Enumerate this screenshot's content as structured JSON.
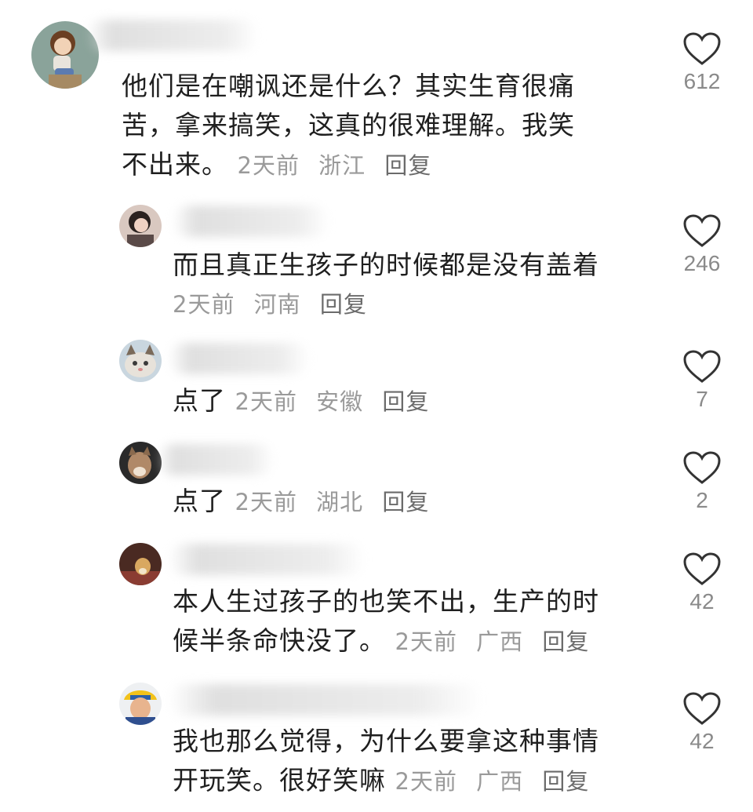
{
  "colors": {
    "text": "#1f1f1f",
    "meta": "#9a9a9a",
    "reply": "#6b6b6b",
    "heart": "#333333",
    "count": "#8a8a8a"
  },
  "comments": [
    {
      "kind": "top",
      "avatar_icon": "cartoon-girl-avatar-icon",
      "text": "他们是在嘲讽还是什么？其实生育很痛苦，拿来搞笑，这真的很难理解。我笑不出来。",
      "text_lines": [
        "他们是在嘲讽还是什么？其实生育很痛",
        "苦，拿来搞笑，这真的很难理解。我笑",
        "不出来。"
      ],
      "time": "2天前",
      "location": "浙江",
      "reply": "回复",
      "likes": "612"
    },
    {
      "kind": "reply",
      "avatar_icon": "woman-photo-avatar-icon",
      "text_lines": [
        "而且真正生孩子的时候都是没有盖着"
      ],
      "time": "2天前",
      "location": "河南",
      "reply": "回复",
      "likes": "246"
    },
    {
      "kind": "reply",
      "avatar_icon": "cat-avatar-icon",
      "text_lines": [
        "点了"
      ],
      "time": "2天前",
      "location": "安徽",
      "reply": "回复",
      "likes": "7"
    },
    {
      "kind": "reply",
      "avatar_icon": "cat-photo-avatar-icon",
      "text_lines": [
        "点了"
      ],
      "time": "2天前",
      "location": "湖北",
      "reply": "回复",
      "likes": "2"
    },
    {
      "kind": "reply",
      "avatar_icon": "dog-avatar-icon",
      "text_lines": [
        "本人生过孩子的也笑不出，生产的时",
        "候半条命快没了。"
      ],
      "time": "2天前",
      "location": "广西",
      "reply": "回复",
      "likes": "42"
    },
    {
      "kind": "reply",
      "avatar_icon": "man-yellow-hat-avatar-icon",
      "text_lines": [
        "我也那么觉得，为什么要拿这种事情",
        "开玩笑。很好笑嘛"
      ],
      "time": "2天前",
      "location": "广西",
      "reply": "回复",
      "likes": "42"
    }
  ]
}
